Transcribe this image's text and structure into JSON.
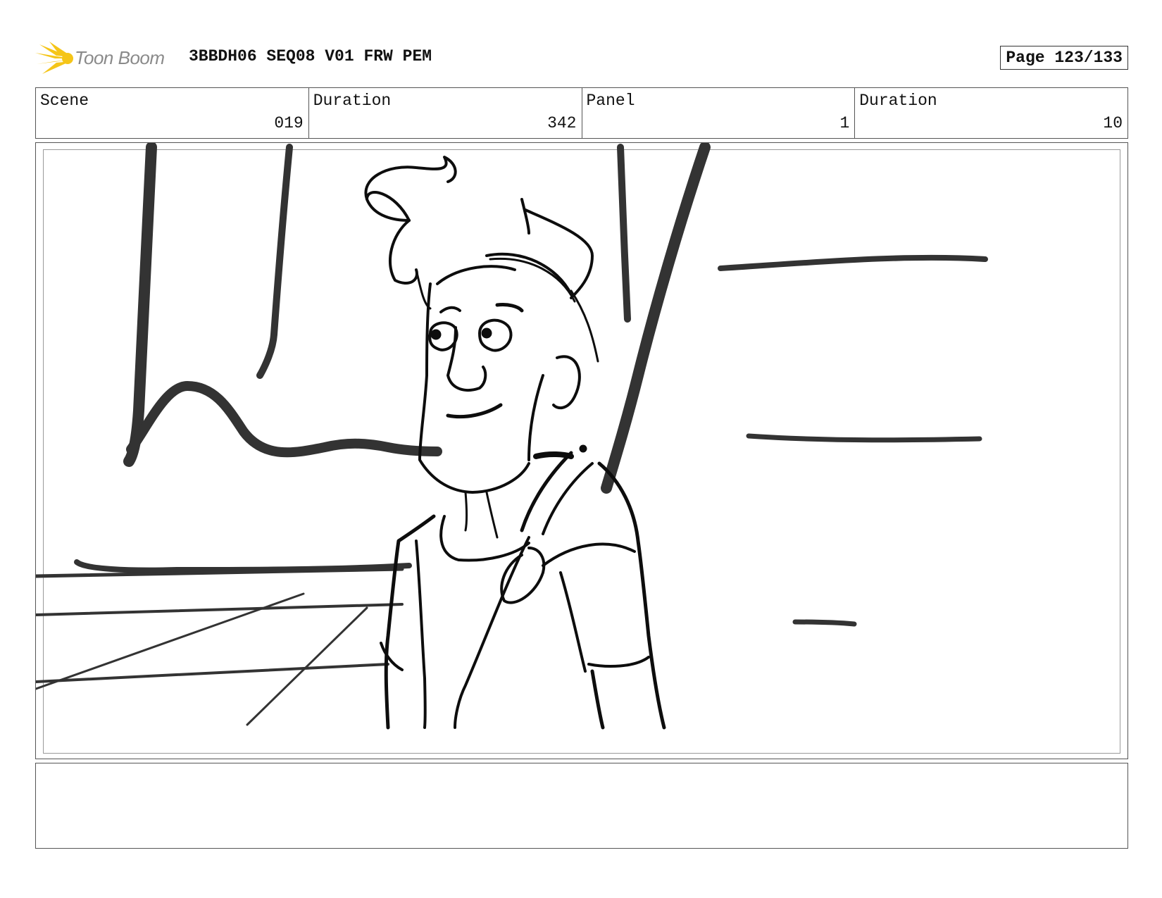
{
  "header": {
    "logo_text": "Toon Boom",
    "title": "3BBDH06 SEQ08 V01 FRW PEM",
    "page": "Page 123/133"
  },
  "info": {
    "scene_label": "Scene",
    "scene_value": "019",
    "scene_duration_label": "Duration",
    "scene_duration_value": "342",
    "panel_label": "Panel",
    "panel_value": "1",
    "panel_duration_label": "Duration",
    "panel_duration_value": "10"
  },
  "colors": {
    "logo_yellow": "#f5c518",
    "ink": "#111111",
    "background_ink": "#333333"
  },
  "notes": ""
}
